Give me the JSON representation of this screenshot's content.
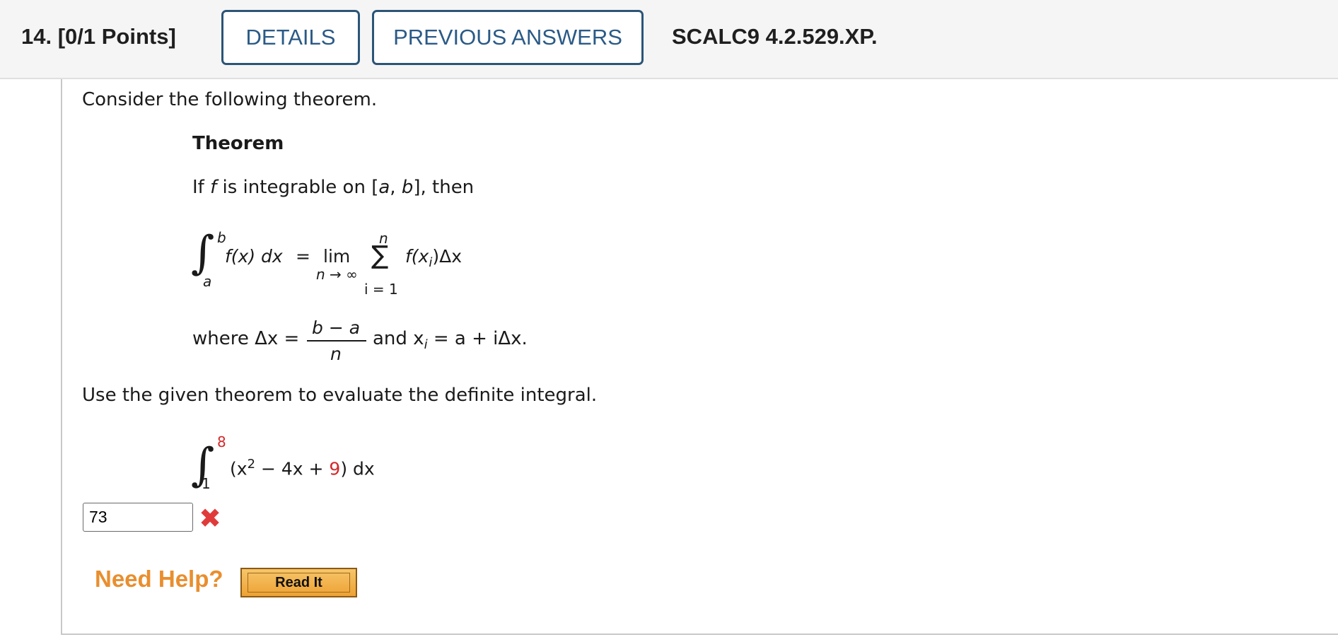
{
  "header": {
    "question_label": "14.  [0/1 Points]",
    "details_label": "DETAILS",
    "previous_answers_label": "PREVIOUS ANSWERS",
    "question_id": "SCALC9 4.2.529.XP."
  },
  "body": {
    "intro": "Consider the following theorem.",
    "theorem_title": "Theorem",
    "condition_pre": "If ",
    "condition_f": "f",
    "condition_mid": " is integrable on [",
    "condition_a": "a",
    "condition_comma": ", ",
    "condition_b": "b",
    "condition_post": "], then",
    "theorem_formula": {
      "upper": "b",
      "lower": "a",
      "integrand": "f(x) dx",
      "equals": "=",
      "lim": "lim",
      "lim_sub": "n → ∞",
      "sigma": "∑",
      "sigma_top": "n",
      "sigma_bottom": "i = 1",
      "summand": "f(x",
      "summand_sub": "i",
      "summand_post": ")Δx"
    },
    "where": {
      "label": "where Δx =",
      "numerator": "b − a",
      "denominator": "n",
      "and_text": "and x",
      "sub": "i",
      "post": " = a + iΔx."
    },
    "task": "Use the given theorem to evaluate the definite integral.",
    "integral": {
      "upper": "8",
      "lower": "1",
      "open": "(x",
      "power": "2",
      "middle": " − 4x + ",
      "constant": "9",
      "close": ") dx"
    }
  },
  "answer": {
    "value": "73",
    "status_icon": "x-mark-icon",
    "status_color": "#e03b3b"
  },
  "help": {
    "label": "Need Help?",
    "read_it_label": "Read It"
  },
  "colors": {
    "link": "#2b5a86",
    "help": "#e98e2e",
    "highlight": "#d4282b"
  }
}
